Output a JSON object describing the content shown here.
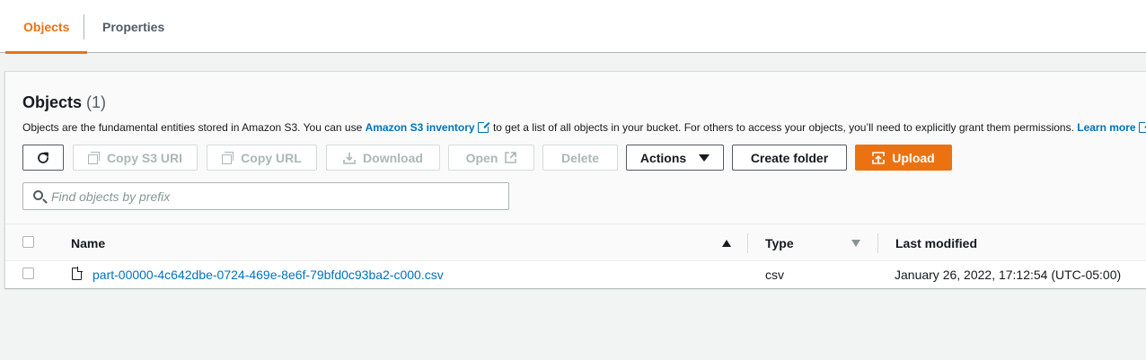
{
  "tabs": {
    "objects": "Objects",
    "properties": "Properties"
  },
  "panel": {
    "title": "Objects",
    "count": "(1)",
    "description_1": "Objects are the fundamental entities stored in Amazon S3. You can use ",
    "inventory_link": "Amazon S3 inventory",
    "description_2": " to get a list of all objects in your bucket. For others to access your objects, you’ll need to explicitly grant them permissions. ",
    "learn_more": "Learn more"
  },
  "toolbar": {
    "refresh_icon": "refresh-icon",
    "copy_s3_uri": "Copy S3 URI",
    "copy_url": "Copy URL",
    "download": "Download",
    "open": "Open",
    "delete": "Delete",
    "actions": "Actions",
    "create_folder": "Create folder",
    "upload": "Upload"
  },
  "search": {
    "placeholder": "Find objects by prefix"
  },
  "table": {
    "columns": [
      "Name",
      "Type",
      "Last modified"
    ],
    "rows": [
      {
        "name": "part-00000-4c642dbe-0724-469e-8e6f-79bfd0c93ba2-c000.csv",
        "type": "csv",
        "last_modified": "January 26, 2022, 17:12:54 (UTC-05:00)"
      }
    ]
  },
  "colors": {
    "accent": "#ec7211",
    "link": "#0073bb",
    "disabled": "#aab7b8"
  }
}
